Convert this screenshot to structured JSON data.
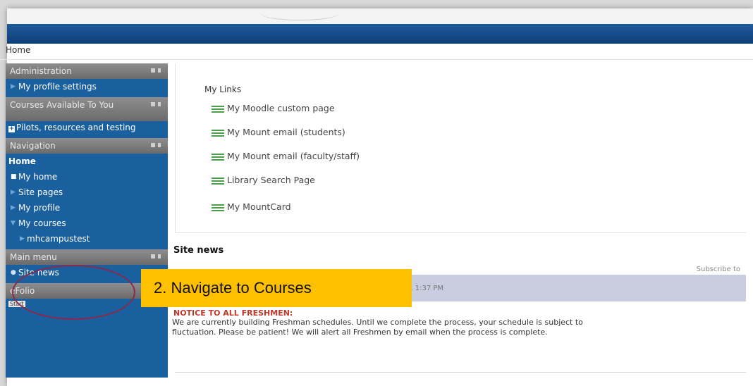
{
  "breadcrumb": "Home",
  "sidebar": {
    "administration": {
      "title": "Administration",
      "items": [
        "My profile settings"
      ]
    },
    "courses_available": {
      "title": "Courses Available To You",
      "items": [
        "Pilots, resources and testing"
      ]
    },
    "navigation": {
      "title": "Navigation",
      "home": "Home",
      "items": [
        "My home",
        "Site pages",
        "My profile",
        "My courses"
      ],
      "course": "mhcampustest"
    },
    "main_menu": {
      "title": "Main menu",
      "items": [
        "Site news"
      ]
    },
    "efolio": {
      "title": "eFolio",
      "start_label": "Start"
    }
  },
  "main": {
    "my_links_title": "My Links",
    "links": [
      "My Moodle custom page",
      "My Mount email (students)",
      "My Mount email (faculty/staff)",
      "Library Search Page",
      "My MountCard"
    ],
    "site_news_title": "Site news",
    "subscribe": "Subscribe to",
    "post_time": "4, 1:37 PM",
    "notice_title": "NOTICE TO ALL FRESHMEN:",
    "notice_body_1": "We are currently building Freshman schedules. Until we complete the process, your schedule is subject to",
    "notice_body_2": "fluctuation. Please be patient! We will alert all Freshmen by email when the process is complete."
  },
  "callout": "2. Navigate to Courses",
  "colors": {
    "navy": "#1a5f9e",
    "callout": "#ffc000",
    "notice": "#c0392b"
  }
}
